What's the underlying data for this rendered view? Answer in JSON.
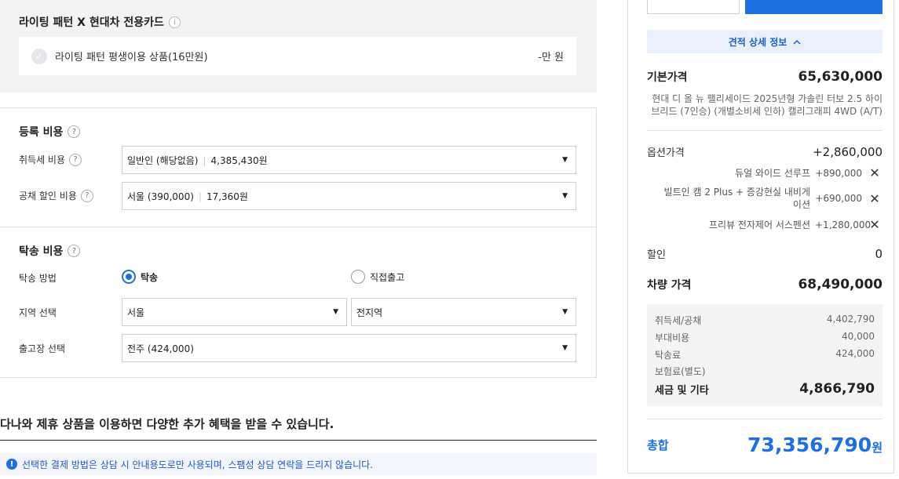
{
  "lighting": {
    "title": "라이팅 패턴 X 현대차 전용카드",
    "info_icon": "i",
    "item_label": "라이팅 패턴 평생이용 상품(16만원)",
    "item_price": "-만 원"
  },
  "registration": {
    "title": "등록 비용",
    "help_icon": "?",
    "acquisition_label": "취득세 비용",
    "acquisition_select_main": "일반인 (해당없음)",
    "acquisition_select_value": "4,385,430원",
    "bond_label": "공채 할인 비용",
    "bond_select_main": "서울 (390,000)",
    "bond_select_value": "17,360원"
  },
  "delivery": {
    "title": "탁송 비용",
    "method_label": "탁송 방법",
    "method_option_delivery": "탁송",
    "method_option_direct": "직접출고",
    "region_label": "지역 선택",
    "region_select": "서울",
    "region_sub_select": "전지역",
    "depot_label": "출고장 선택",
    "depot_select": "전주 (424,000)"
  },
  "promo": {
    "headline": "다나와 제휴 상품을 이용하면 다양한 추가 혜택을 받을 수 있습니다.",
    "notice": "선택한 결제 방법은 상담 시 안내용도로만 사용되며, 스팸성 상담 연락을 드리지 않습니다.",
    "notice_icon": "!"
  },
  "summary": {
    "detail_toggle": "견적 상세 정보",
    "base_label": "기본가격",
    "base_value": "65,630,000",
    "base_desc": "현대 디 올 뉴 팰리세이드 2025년형 가솔린 터보 2.5 하이브리드 (7인승) (개별소비세 인하) 캘리그래피 4WD (A/T)",
    "option_label": "옵션가격",
    "option_value": "+2,860,000",
    "options": [
      {
        "name": "듀얼 와이드 선루프",
        "price": "+890,000"
      },
      {
        "name": "빌트인 캠 2 Plus + 증강현실 내비게이션",
        "price": "+690,000"
      },
      {
        "name": "프리뷰 전자제어 서스펜션",
        "price": "+1,280,000"
      }
    ],
    "discount_label": "할인",
    "discount_value": "0",
    "vehicle_label": "차량 가격",
    "vehicle_value": "68,490,000",
    "sub": {
      "tax_label": "취득세/공채",
      "tax_value": "4,402,790",
      "extra_label": "부대비용",
      "extra_value": "40,000",
      "delivery_label": "탁송료",
      "delivery_value": "424,000",
      "insurance_label": "보험료(별도)",
      "total_label": "세금 및 기타",
      "total_value": "4,866,790"
    },
    "grand_label": "총합",
    "grand_value": "73,356,790",
    "grand_unit": "원"
  },
  "colors": {
    "accent": "#1e6fe0",
    "panel_bg": "#f2f3f5"
  }
}
